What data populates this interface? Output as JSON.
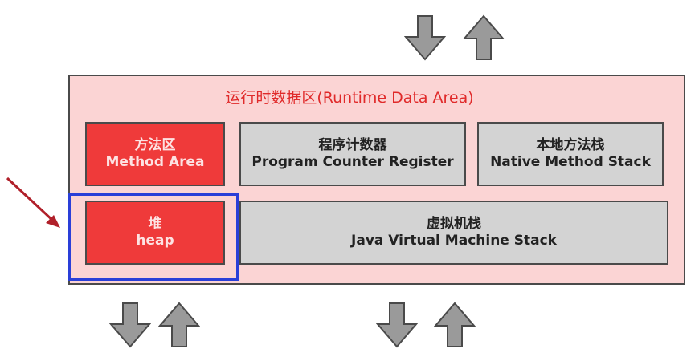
{
  "colors": {
    "area_fill": "#fbd4d4",
    "title_red": "#e02a2a",
    "red_box": "#ef3a3a",
    "gray_box": "#d3d3d3",
    "highlight": "#2a3fd8",
    "pointer_arrow": "#b0202a",
    "flow_arrow_fill": "#9a9a9a"
  },
  "runtime_data_area": {
    "title": "运行时数据区(Runtime Data Area)",
    "method_area": {
      "cn": "方法区",
      "en": "Method Area"
    },
    "pc_register": {
      "cn": "程序计数器",
      "en": "Program Counter Register"
    },
    "native_stack": {
      "cn": "本地方法栈",
      "en": "Native Method Stack"
    },
    "heap": {
      "cn": "堆",
      "en": "heap"
    },
    "jvm_stack": {
      "cn": "虚拟机栈",
      "en": "Java Virtual Machine Stack"
    }
  },
  "icons": {
    "flow_down": "arrow-down-icon",
    "flow_up": "arrow-up-icon",
    "pointer": "pointer-arrow-icon"
  }
}
